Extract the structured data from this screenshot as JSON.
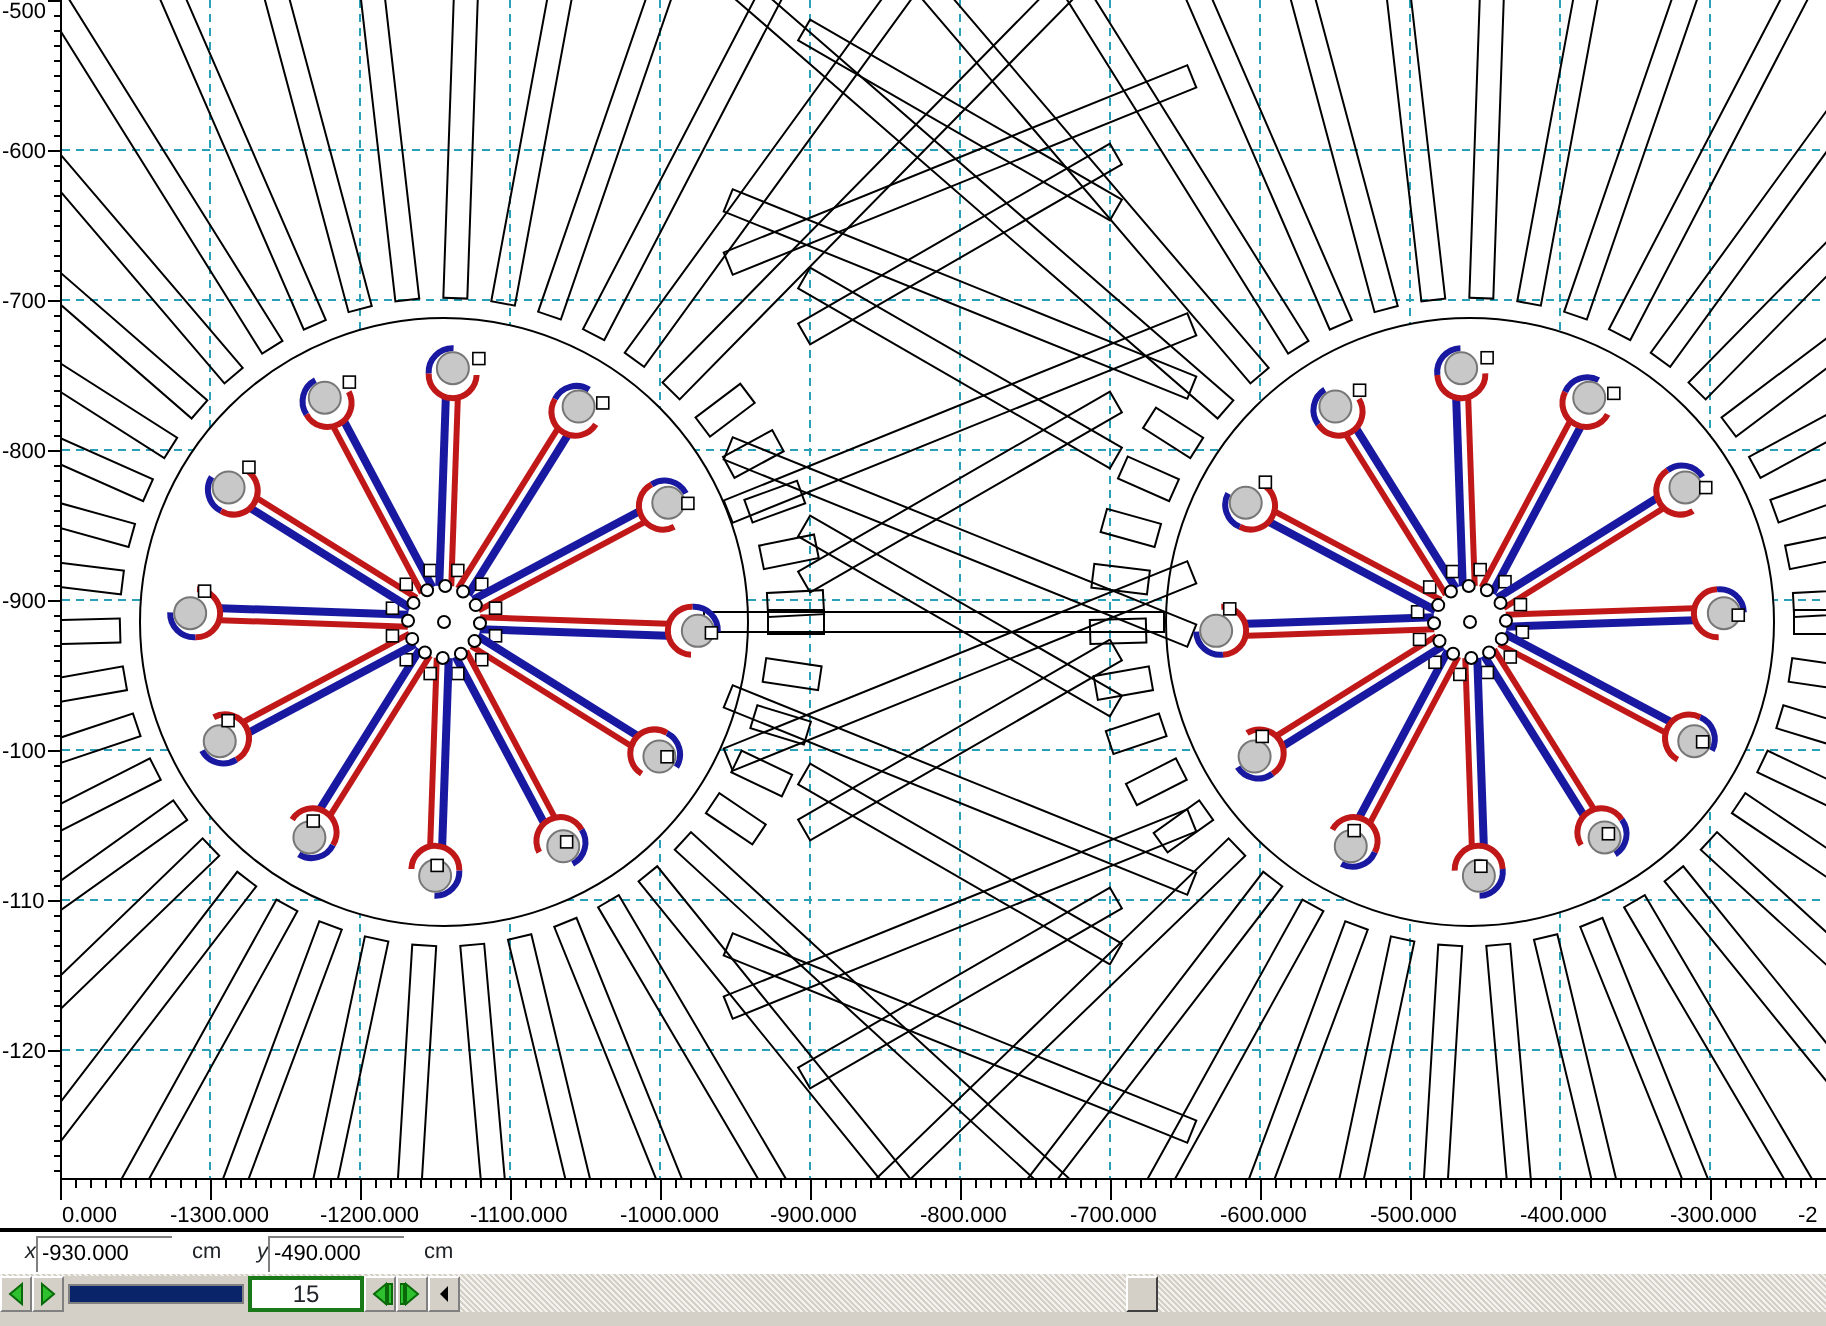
{
  "plot": {
    "y_axis_labels": [
      "-500",
      "-600",
      "-700",
      "-800",
      "-900",
      "-100",
      "-110",
      "-120"
    ],
    "x_axis_labels": [
      "0.000",
      "-1300.000",
      "-1200.000",
      "-1100.000",
      "-1000.000",
      "-900.000",
      "-800.000",
      "-700.000",
      "-600.000",
      "-500.000",
      "-400.000",
      "-300.000",
      "-2"
    ]
  },
  "coordinates": [
    {
      "label": "x",
      "value": "-930.000",
      "unit": "cm"
    },
    {
      "label": "y",
      "value": "-490.000",
      "unit": "cm"
    }
  ],
  "playback": {
    "frame": "15",
    "level": 1
  }
}
